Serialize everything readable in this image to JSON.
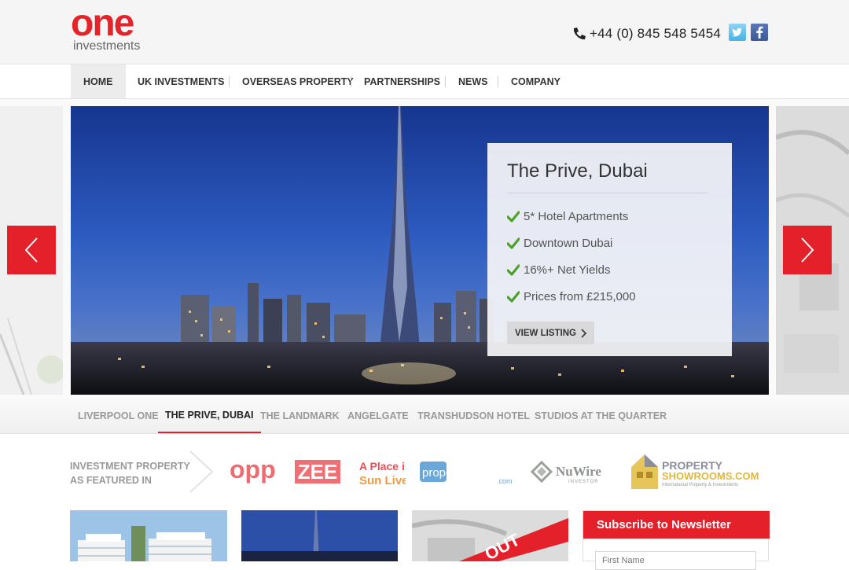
{
  "header": {
    "logo_main": "one",
    "logo_sub": "investments",
    "phone": "+44 (0) 845 548 5454",
    "icons": [
      "phone-icon",
      "twitter-icon",
      "facebook-icon"
    ]
  },
  "nav": {
    "items": [
      "HOME",
      "UK INVESTMENTS",
      "OVERSEAS PROPERTY",
      "PARTNERSHIPS",
      "NEWS",
      "COMPANY"
    ],
    "active": "HOME"
  },
  "slider": {
    "title": "The Prive, Dubai",
    "features": [
      "5* Hotel Apartments",
      "Downtown Dubai",
      "16%+ Net Yields",
      "Prices from £215,000"
    ],
    "button": "VIEW LISTING",
    "tabs": [
      "LIVERPOOL ONE",
      "THE PRIVE, DUBAI",
      "THE LANDMARK",
      "ANGELGATE",
      "TRANSHUDSON HOTEL",
      "STUDIOS AT THE QUARTER"
    ],
    "active_tab": "THE PRIVE, DUBAI"
  },
  "featured": {
    "label_line1": "INVESTMENT PROPERTY",
    "label_line2": "AS FEATURED IN",
    "logos": {
      "opp": "opp",
      "zee": "ZEE",
      "aplace_1": "A Place in",
      "aplace_2": "Sun Live",
      "pa_main": "property-abroad",
      "pa_sub": ".com",
      "nuwire": "NuWire",
      "nuwire_sub": "INVESTOR",
      "ps_1": "PROPERTY",
      "ps_2": "SHOWROOMS.COM",
      "ps_sub": "International Property & Investments"
    }
  },
  "cards": {
    "sold_out": "OUT"
  },
  "newsletter": {
    "title": "Subscribe to Newsletter",
    "first_name_placeholder": "First Name"
  },
  "colors": {
    "brand_red": "#e4202a",
    "text_dark": "#333333",
    "muted": "#999999"
  }
}
